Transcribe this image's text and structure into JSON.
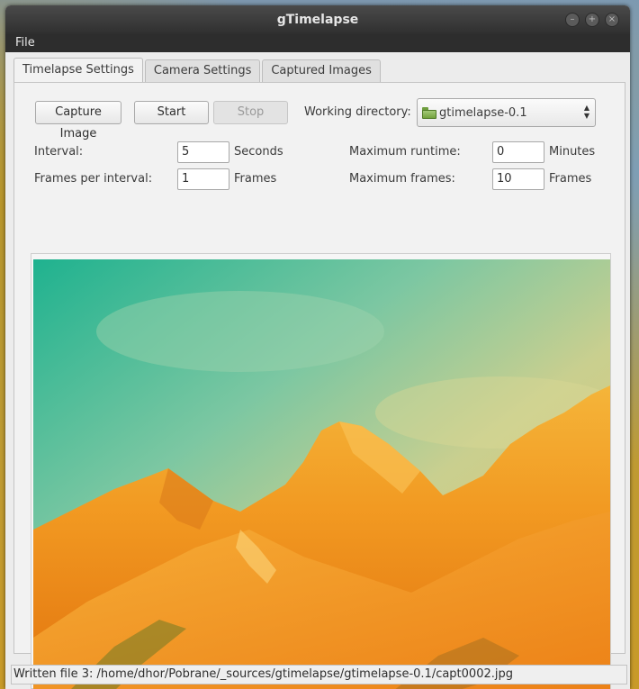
{
  "window": {
    "title": "gTimelapse"
  },
  "menu": {
    "file": "File"
  },
  "tabs": [
    {
      "label": "Timelapse Settings",
      "active": true
    },
    {
      "label": "Camera Settings",
      "active": false
    },
    {
      "label": "Captured Images",
      "active": false
    }
  ],
  "toolbar": {
    "capture_label": "Capture Image",
    "start_label": "Start",
    "stop_label": "Stop",
    "stop_enabled": false
  },
  "working_directory": {
    "label": "Working directory:",
    "value": "gtimelapse-0.1",
    "icon": "folder-icon"
  },
  "settings": {
    "interval": {
      "label": "Interval:",
      "value": "5",
      "unit": "Seconds"
    },
    "frames_per_interval": {
      "label": "Frames per interval:",
      "value": "1",
      "unit": "Frames"
    },
    "max_runtime": {
      "label": "Maximum runtime:",
      "value": "0",
      "unit": "Minutes"
    },
    "max_frames": {
      "label": "Maximum frames:",
      "value": "10",
      "unit": "Frames"
    }
  },
  "preview": {
    "subject": "orange-tinted mountain ridge under teal sky"
  },
  "status": {
    "text": "Written file 3: /home/dhor/Pobrane/_sources/gtimelapse/gtimelapse-0.1/capt0002.jpg"
  },
  "colors": {
    "titlebar": "#2f2f2f",
    "window_bg": "#ececec",
    "folder_green": "#73a33d",
    "sky_teal": "#2fb595",
    "mountain_orange": "#f08a1a"
  }
}
